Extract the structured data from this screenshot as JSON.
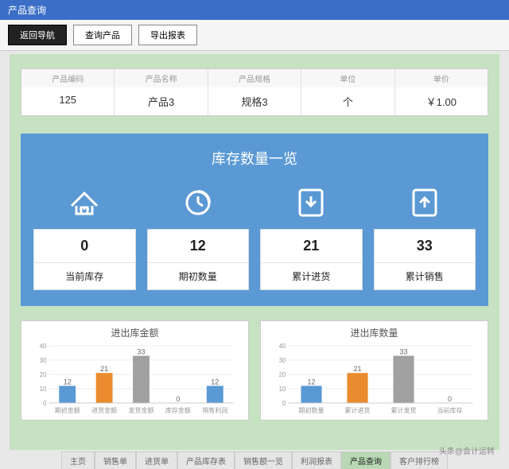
{
  "window": {
    "title": "产品查询"
  },
  "toolbar": {
    "back": "返回导航",
    "query": "查询产品",
    "export": "导出报表"
  },
  "fields": {
    "code": {
      "label": "产品编码",
      "value": "125"
    },
    "name": {
      "label": "产品名称",
      "value": "产品3"
    },
    "spec": {
      "label": "产品规格",
      "value": "规格3"
    },
    "unit": {
      "label": "单位",
      "value": "个"
    },
    "price": {
      "label": "单价",
      "value": "￥1.00"
    }
  },
  "panel": {
    "title": "库存数量一览",
    "cards": [
      {
        "icon": "house",
        "value": "0",
        "label": "当前库存"
      },
      {
        "icon": "clock",
        "value": "12",
        "label": "期初数量"
      },
      {
        "icon": "download",
        "value": "21",
        "label": "累计进货"
      },
      {
        "icon": "upload",
        "value": "33",
        "label": "累计销售"
      }
    ]
  },
  "chart_data": [
    {
      "type": "bar",
      "title": "进出库金额",
      "ylim": [
        0,
        40
      ],
      "categories": [
        "期初金额",
        "进货金额",
        "发货金额",
        "库存金额",
        "销售利润"
      ],
      "values": [
        12,
        21,
        33,
        0,
        12
      ],
      "colors": [
        "bar1",
        "bar2",
        "bar3",
        "bar4",
        "bar5"
      ]
    },
    {
      "type": "bar",
      "title": "进出库数量",
      "ylim": [
        0,
        40
      ],
      "categories": [
        "期初数量",
        "累计进货",
        "累计发货",
        "当前库存"
      ],
      "values": [
        12,
        21,
        33,
        0
      ],
      "colors": [
        "bar1",
        "bar2",
        "bar3",
        "bar4"
      ]
    }
  ],
  "tabs": [
    "主页",
    "销售单",
    "进货单",
    "产品库存表",
    "销售额一览",
    "利润报表",
    "产品查询",
    "客户排行榜"
  ],
  "active_tab": "产品查询",
  "footer": "头条@会计运转"
}
